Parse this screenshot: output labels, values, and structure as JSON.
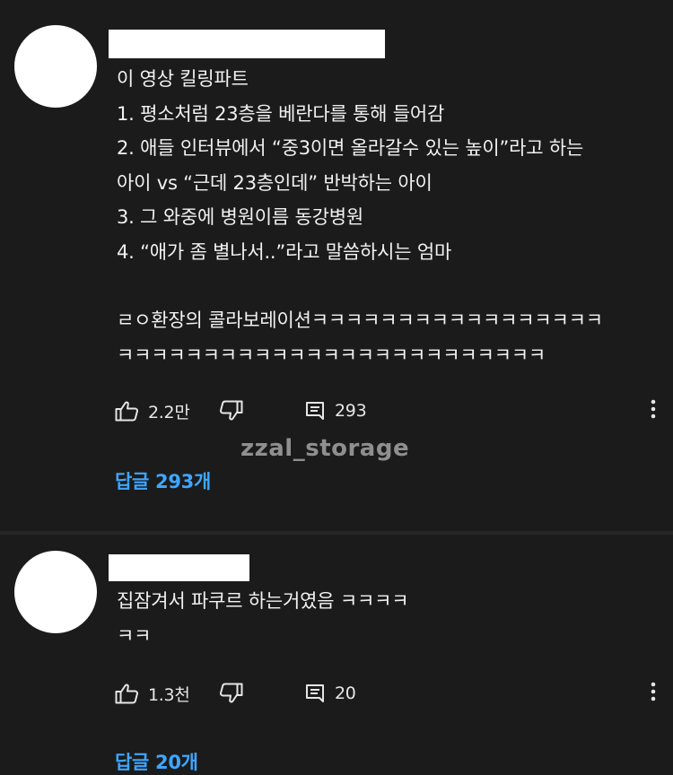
{
  "watermark": "zzal_storage",
  "comments": [
    {
      "lines": [
        "이 영상 킬링파트",
        "1. 평소처럼 23층을 베란다를 통해 들어감",
        "2. 애들 인터뷰에서 “중3이면 올라갈수 있는 높이”라고 하는",
        "아이 vs “근데 23층인데” 반박하는 아이",
        "3. 그 와중에 병원이름 동강병원",
        "4. “애가 좀 별나서..”라고 말씀하시는 엄마",
        "ㄹㅇ환장의 콜라보레이션ㅋㅋㅋㅋㅋㅋㅋㅋㅋㅋㅋㅋㅋㅋㅋㅋㅋ",
        "ㅋㅋㅋㅋㅋㅋㅋㅋㅋㅋㅋㅋㅋㅋㅋㅋㅋㅋㅋㅋㅋㅋㅋㅋㅋ"
      ],
      "likes": "2.2만",
      "reply_count": "293",
      "replies_label": "답글 293개",
      "icons": [
        "thumbs-up-icon",
        "thumbs-down-icon",
        "reply-icon",
        "more-vert-icon"
      ]
    },
    {
      "lines": [
        "집잠겨서 파쿠르 하는거였음 ㅋㅋㅋㅋ",
        "ㅋㅋ"
      ],
      "likes": "1.3천",
      "reply_count": "20",
      "replies_label": "답글 20개",
      "icons": [
        "thumbs-up-icon",
        "thumbs-down-icon",
        "reply-icon",
        "more-vert-icon"
      ]
    }
  ],
  "colors": {
    "background": "#1b1b1b",
    "text": "#f2f2f2",
    "link": "#3ea6ff",
    "watermark": "#8f8f8f"
  }
}
